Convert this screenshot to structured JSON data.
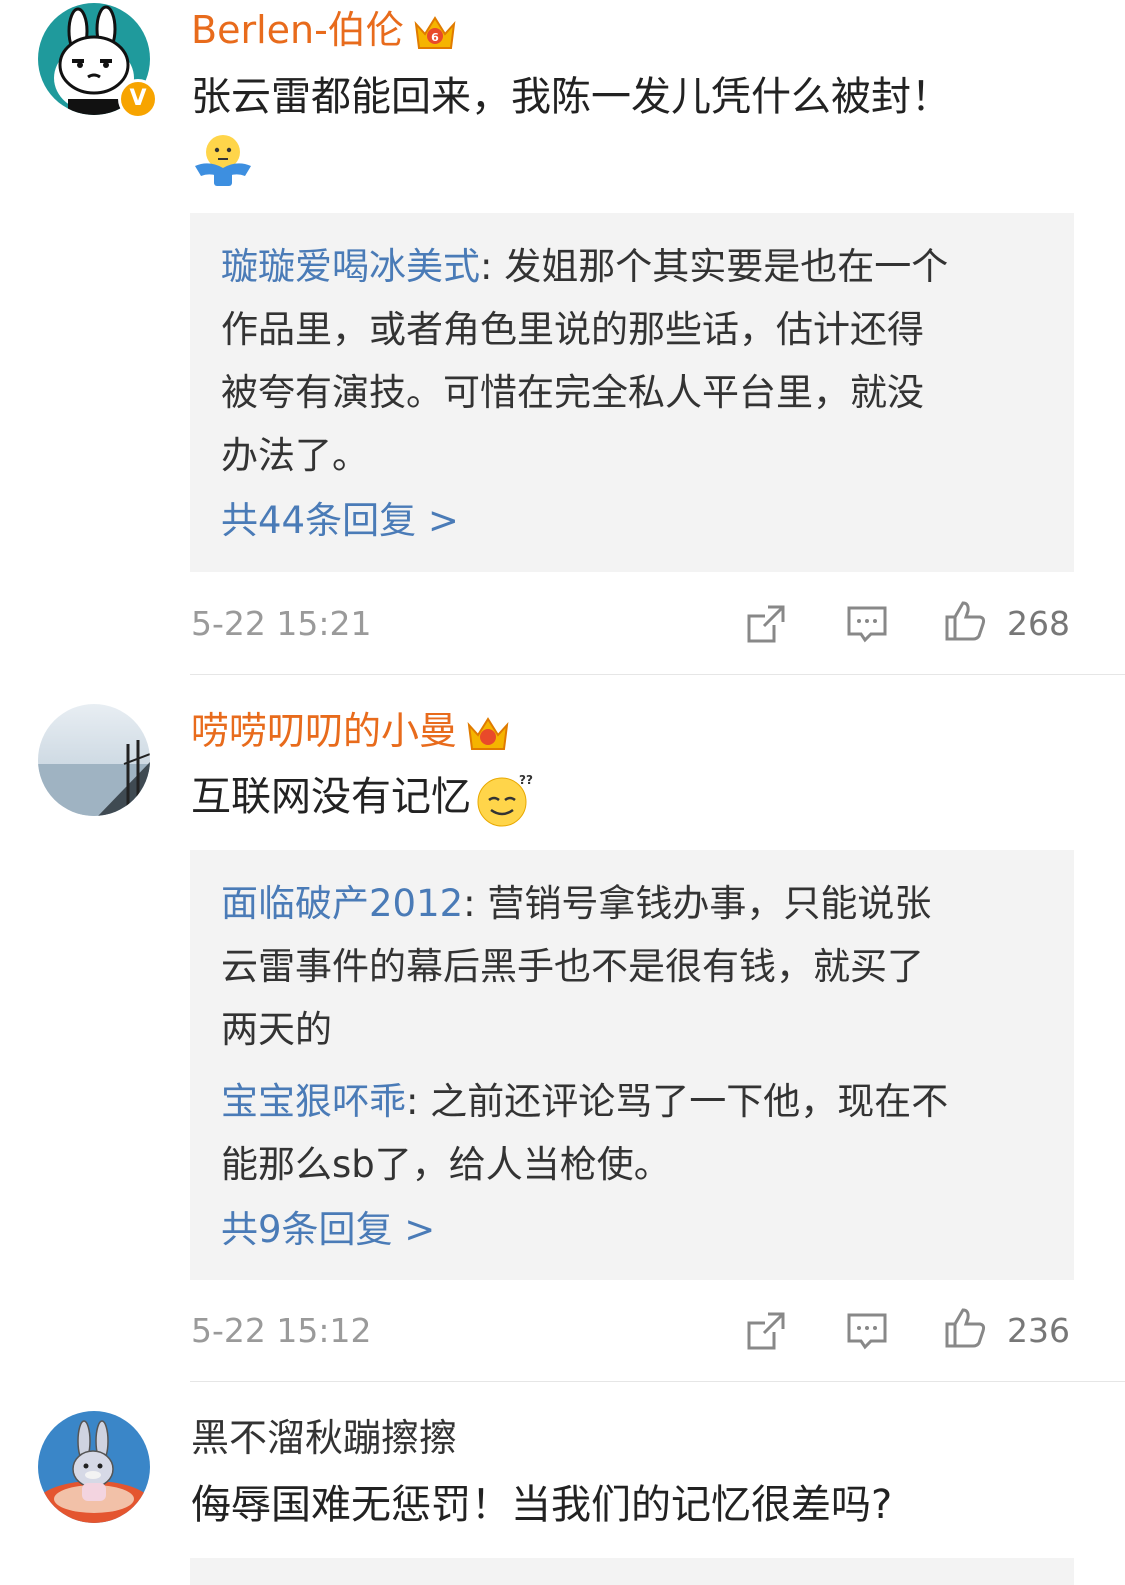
{
  "comments": [
    {
      "username": "Berlen-伯伦",
      "text": "张云雷都能回来，我陈一发儿凭什么被封！",
      "emoji": "shrug-emoji",
      "replies": [
        {
          "name": "璇璇爱喝冰美式",
          "lines": [
            "发姐那个其实要是也在一个",
            "作品里，或者角色里说的那些话，估计还得",
            "被夸有演技。可惜在完全私人平台里，就没",
            "办法了。"
          ]
        }
      ],
      "more_replies": "共44条回复 >",
      "time": "5-22 15:21",
      "likes": "268"
    },
    {
      "username": "唠唠叨叨的小曼",
      "text": "互联网没有记忆",
      "emoji": "confused-emoji",
      "replies": [
        {
          "name": "面临破产2012",
          "lines": [
            "营销号拿钱办事，只能说张",
            "云雷事件的幕后黑手也不是很有钱，就买了",
            "两天的"
          ]
        },
        {
          "name": "宝宝狠吥乖",
          "lines": [
            "之前还评论骂了一下他，现在不",
            "能那么sb了，给人当枪使。"
          ]
        }
      ],
      "more_replies": "共9条回复 >",
      "time": "5-22 15:12",
      "likes": "236"
    },
    {
      "username": "黑不溜秋蹦擦擦",
      "text": "侮辱国难无惩罚！当我们的记忆很差吗?"
    }
  ],
  "colors": {
    "username_orange": "#e86b1c",
    "reply_name_blue": "#4a7bb7",
    "reply_bg": "#f3f3f3",
    "time_gray": "#9a9a9a"
  }
}
